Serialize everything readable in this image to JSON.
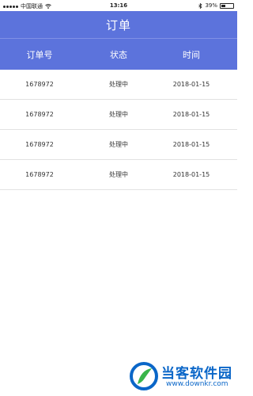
{
  "status_bar": {
    "carrier": "中国联通",
    "time": "13:16",
    "battery": "39%",
    "battery_level": 0.39
  },
  "header": {
    "title": "订单"
  },
  "table": {
    "columns": [
      "订单号",
      "状态",
      "时间"
    ],
    "rows": [
      [
        "1678972",
        "处理中",
        "2018-01-15"
      ],
      [
        "1678972",
        "处理中",
        "2018-01-15"
      ],
      [
        "1678972",
        "处理中",
        "2018-01-15"
      ],
      [
        "1678972",
        "处理中",
        "2018-01-15"
      ]
    ]
  },
  "watermark": {
    "name": "当客软件园",
    "url": "www.downkr.com"
  },
  "colors": {
    "accent": "#5c73dc",
    "row_border": "#e2e2e2",
    "watermark_blue": "#0a66c8",
    "watermark_green": "#39b54a"
  }
}
